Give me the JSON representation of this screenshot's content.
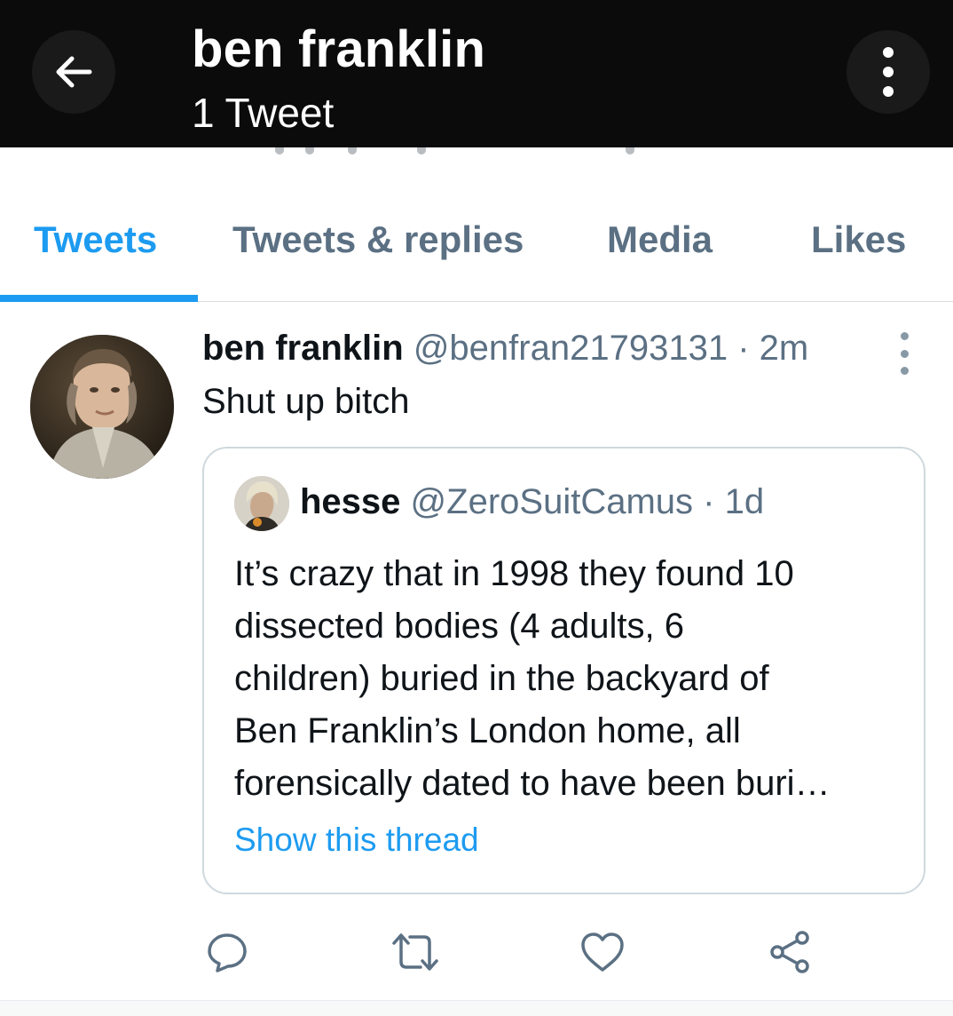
{
  "header": {
    "title": "ben franklin",
    "subtitle": "1 Tweet",
    "back_icon": "arrow-left-icon",
    "more_icon": "vertical-dots-icon"
  },
  "tabs": [
    {
      "label": "Tweets",
      "active": true
    },
    {
      "label": "Tweets & replies",
      "active": false
    },
    {
      "label": "Media",
      "active": false
    },
    {
      "label": "Likes",
      "active": false
    }
  ],
  "tweet": {
    "name": "ben franklin",
    "handle": "@benfran21793131",
    "time": "2m",
    "text": "Shut up bitch",
    "quote": {
      "name": "hesse",
      "handle": "@ZeroSuitCamus",
      "time": "1d",
      "lines": [
        "It’s crazy that in 1998 they found 10",
        "dissected bodies (4 adults, 6",
        "children) buried in the backyard of",
        "Ben Franklin’s London home, all",
        "forensically dated to have been buri…"
      ],
      "thread_link": "Show this thread"
    },
    "actions": [
      "reply-icon",
      "retweet-icon",
      "like-icon",
      "share-icon"
    ]
  },
  "colors": {
    "accent": "#1d9bf0",
    "header_bg": "#0b0b0b",
    "muted": "#5b7083"
  }
}
